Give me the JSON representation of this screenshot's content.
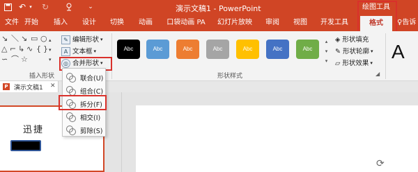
{
  "titlebar": {
    "doc_title": "演示文稿1 - PowerPoint",
    "context_group": "绘图工具",
    "undo_icon": "undo-icon",
    "redo_icon": "redo-icon",
    "save_icon": "save-icon",
    "customize_icon": "chevron-down-icon"
  },
  "tabs": [
    {
      "label": "文件"
    },
    {
      "label": "开始"
    },
    {
      "label": "插入"
    },
    {
      "label": "设计"
    },
    {
      "label": "切换"
    },
    {
      "label": "动画"
    },
    {
      "label": "口袋动画 PA"
    },
    {
      "label": "幻灯片放映"
    },
    {
      "label": "审阅"
    },
    {
      "label": "视图"
    },
    {
      "label": "开发工具"
    },
    {
      "label": "格式"
    },
    {
      "label": "告诉"
    }
  ],
  "ribbon": {
    "insert_shapes": {
      "label": "插入形状",
      "edit_shape": "编辑形状",
      "text_box": "文本框",
      "merge_shapes": "合并形状"
    },
    "shape_styles": {
      "label": "形状样式",
      "swatch_text": "Abc",
      "swatches": [
        {
          "color": "#000000",
          "text": "Abc"
        },
        {
          "color": "#5b9bd5",
          "text": "Abc"
        },
        {
          "color": "#ed7d31",
          "text": "Abc"
        },
        {
          "color": "#a5a5a5",
          "text": "Abc"
        },
        {
          "color": "#ffc000",
          "text": "Abc"
        },
        {
          "color": "#4472c4",
          "text": "Abc"
        },
        {
          "color": "#70ad47",
          "text": "Abc"
        }
      ],
      "shape_fill": "形状填充",
      "shape_outline": "形状轮廓",
      "shape_effects": "形状效果"
    },
    "wordart_letter": "A"
  },
  "merge_menu": {
    "items": [
      {
        "label": "联合(U)"
      },
      {
        "label": "组合(C)"
      },
      {
        "label": "拆分(F)"
      },
      {
        "label": "相交(I)"
      },
      {
        "label": "剪除(S)"
      }
    ]
  },
  "document_tab": {
    "label": "演示文稿1"
  },
  "thumbnail": {
    "text": "迅捷"
  },
  "colors": {
    "accent": "#d04525",
    "highlight": "#d9312b"
  }
}
